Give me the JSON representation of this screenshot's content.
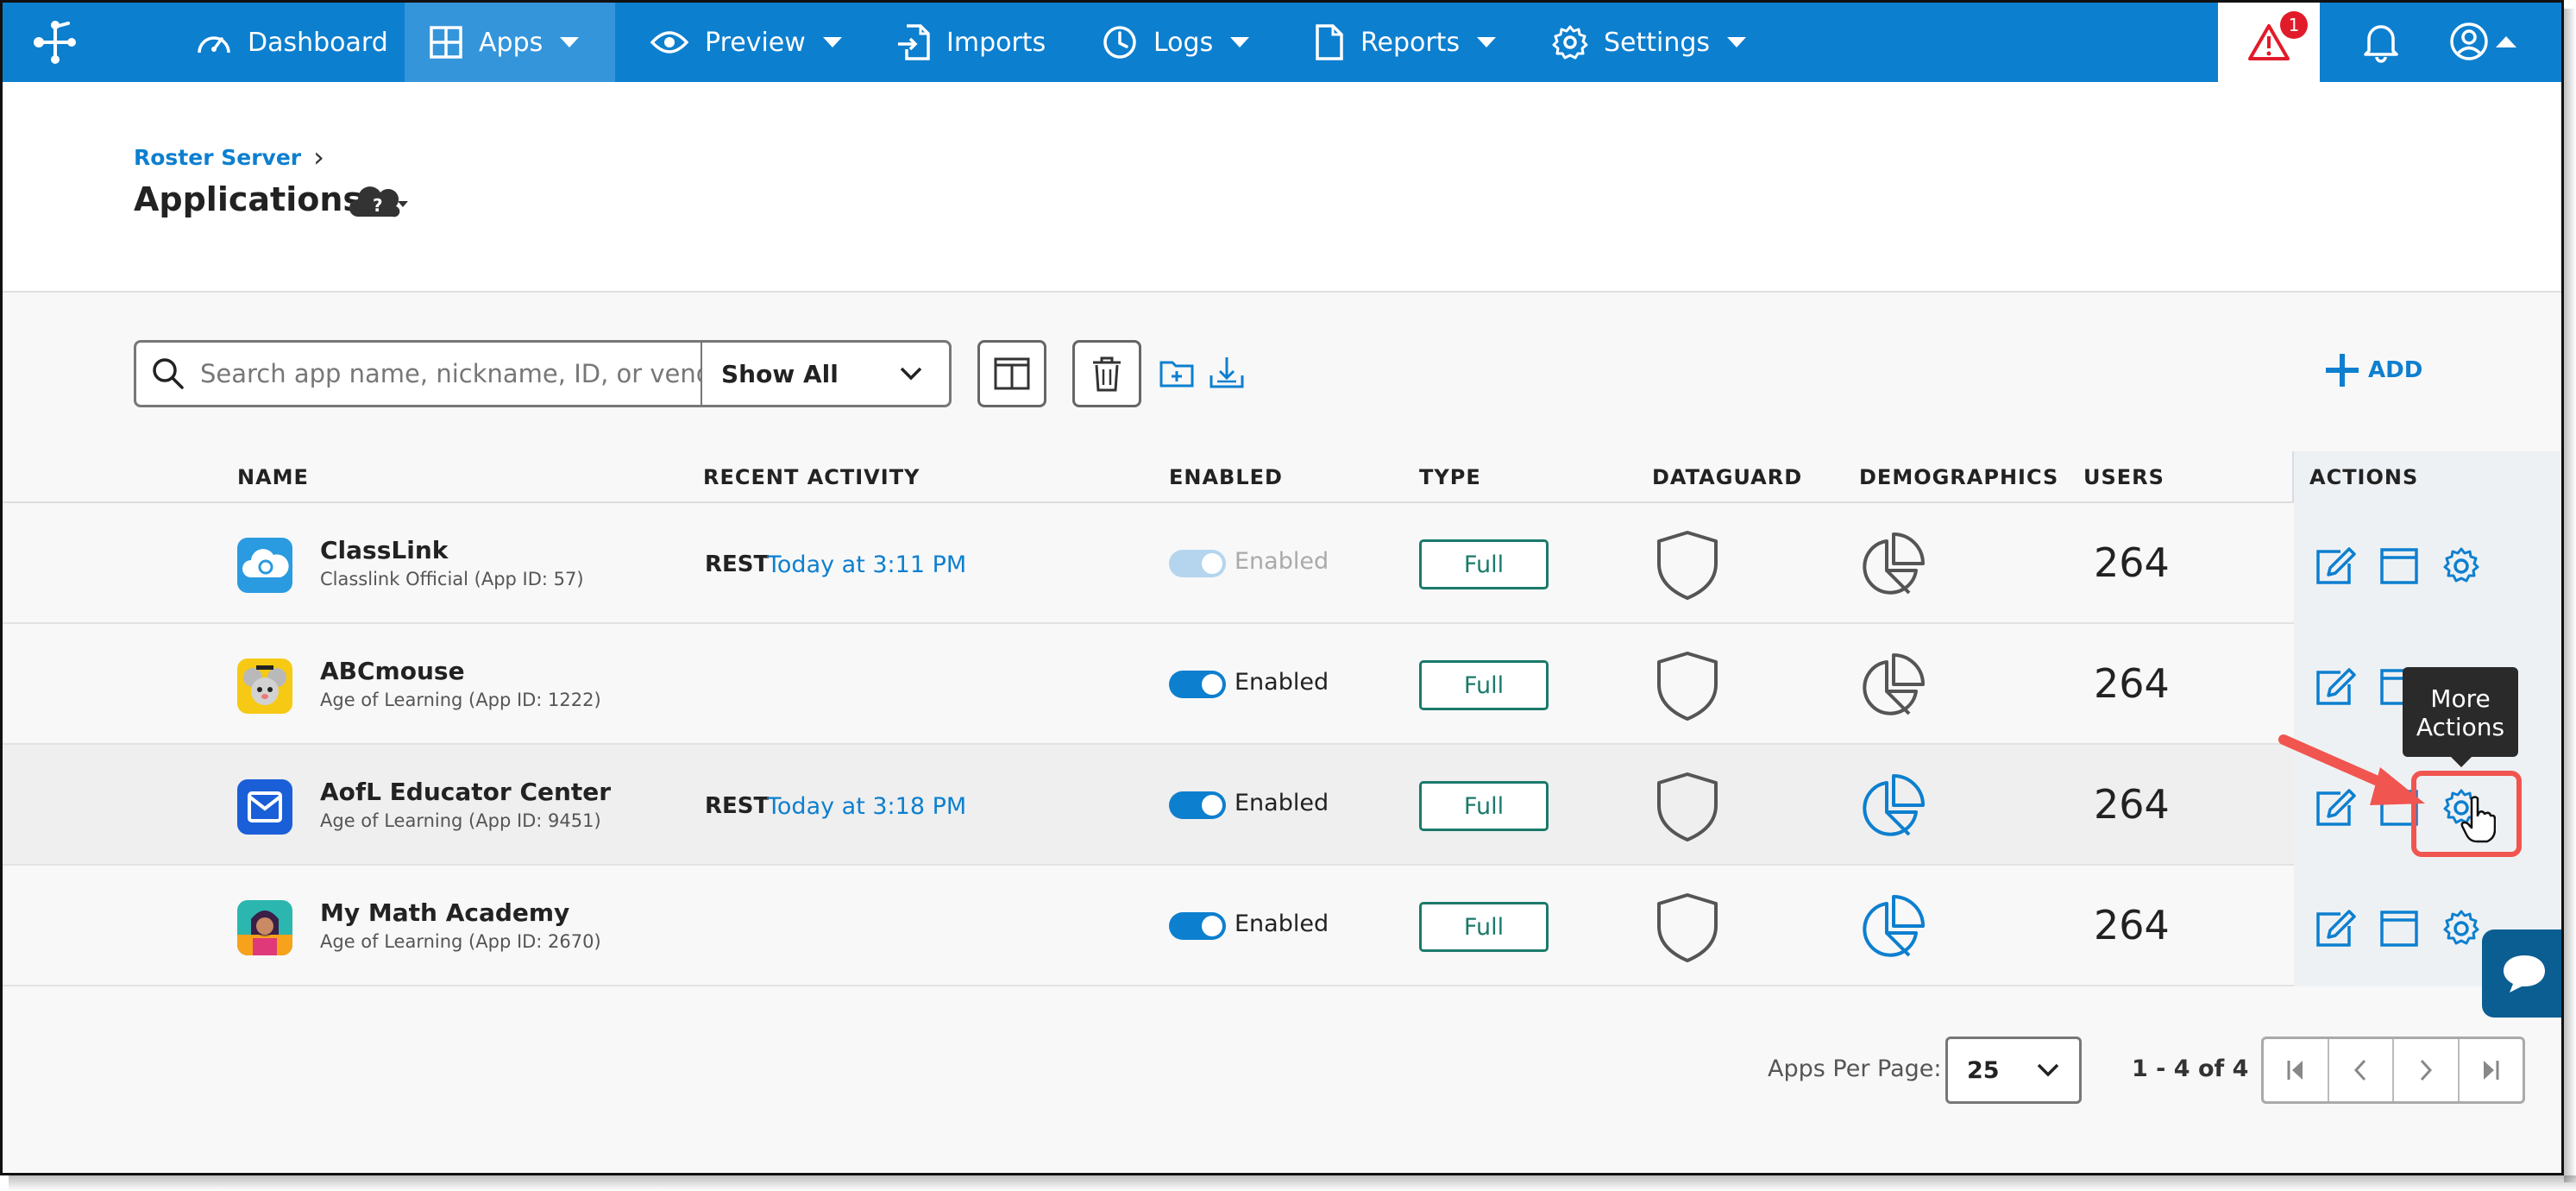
{
  "nav": {
    "items": [
      {
        "label": "Dashboard"
      },
      {
        "label": "Apps"
      },
      {
        "label": "Preview"
      },
      {
        "label": "Imports"
      },
      {
        "label": "Logs"
      },
      {
        "label": "Reports"
      },
      {
        "label": "Settings"
      }
    ],
    "alert_count": "1",
    "active": "Apps"
  },
  "breadcrumb": {
    "root": "Roster Server",
    "separator": "›"
  },
  "page": {
    "title": "Applications",
    "help_glyph": "?"
  },
  "toolbar": {
    "search_placeholder": "Search app name, nickname, ID, or vendor name",
    "filter_value": "Show All",
    "add_label": "ADD"
  },
  "table": {
    "headers": {
      "name": "NAME",
      "recent_activity": "RECENT ACTIVITY",
      "enabled": "ENABLED",
      "type": "TYPE",
      "dataguard": "DATAGUARD",
      "demographics": "DEMOGRAPHICS",
      "users": "USERS",
      "actions": "ACTIONS"
    },
    "rows": [
      {
        "name": "ClassLink",
        "sub": "Classlink Official (App ID: 57)",
        "protocol": "REST",
        "activity": "Today at 3:11 PM",
        "enabled": "Enabled",
        "type": "Full",
        "users": "264"
      },
      {
        "name": "ABCmouse",
        "sub": "Age of Learning (App ID: 1222)",
        "protocol": "",
        "activity": "",
        "enabled": "Enabled",
        "type": "Full",
        "users": "264"
      },
      {
        "name": "AofL Educator Center",
        "sub": "Age of Learning (App ID: 9451)",
        "protocol": "REST",
        "activity": "Today at 3:18 PM",
        "enabled": "Enabled",
        "type": "Full",
        "users": "264"
      },
      {
        "name": "My Math Academy",
        "sub": "Age of Learning (App ID: 2670)",
        "protocol": "",
        "activity": "",
        "enabled": "Enabled",
        "type": "Full",
        "users": "264"
      }
    ]
  },
  "tooltip": {
    "line1": "More",
    "line2": "Actions"
  },
  "pagination": {
    "per_page_label": "Apps Per Page:",
    "per_page_value": "25",
    "range": "1 - 4 of 4"
  },
  "colors": {
    "primary": "#0d7fcf",
    "nav_active": "#3595db",
    "alert": "#e21b2a",
    "badge_border": "#1b7a6a",
    "callout": "#f1554f"
  }
}
